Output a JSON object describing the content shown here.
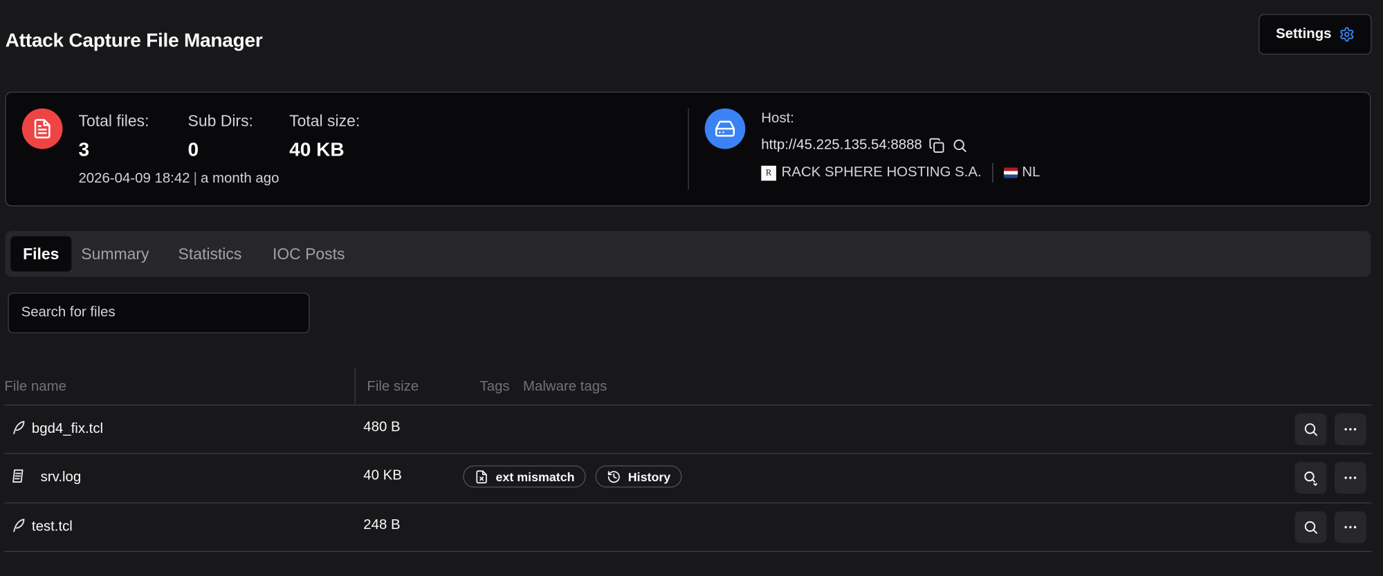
{
  "header": {
    "title": "Attack Capture File Manager",
    "settings_label": "Settings"
  },
  "stats": {
    "total_files_label": "Total files:",
    "total_files_value": "3",
    "sub_dirs_label": "Sub Dirs:",
    "sub_dirs_value": "0",
    "total_size_label": "Total size:",
    "total_size_value": "40 KB",
    "timestamp": "2026-04-09 18:42",
    "relative_time": "a month ago",
    "time_separator": "|"
  },
  "host": {
    "label": "Host:",
    "url": "http://45.225.135.54:8888",
    "org_logo_letter": "R",
    "org_name": "RACK SPHERE HOSTING S.A.",
    "country": "NL"
  },
  "tabs": [
    {
      "label": "Files",
      "active": true
    },
    {
      "label": "Summary",
      "active": false
    },
    {
      "label": "Statistics",
      "active": false
    },
    {
      "label": "IOC Posts",
      "active": false
    }
  ],
  "search": {
    "placeholder": "Search for files",
    "value": ""
  },
  "table": {
    "columns": [
      "File name",
      "File size",
      "Tags",
      "Malware tags"
    ],
    "rows": [
      {
        "name": "bgd4_fix.tcl",
        "size": "480 B",
        "icon": "feather-icon",
        "tags": []
      },
      {
        "name": "srv.log",
        "size": "40 KB",
        "icon": "text-file-icon",
        "tags": [
          {
            "label": "ext mismatch",
            "icon": "file-x-icon"
          },
          {
            "label": "History",
            "icon": "history-icon"
          }
        ]
      },
      {
        "name": "test.tcl",
        "size": "248 B",
        "icon": "feather-icon",
        "tags": []
      }
    ]
  },
  "colors": {
    "background": "#18181b",
    "card": "#09090b",
    "border": "#3f3f46",
    "accent_red": "#ef4444",
    "accent_blue": "#3b82f6",
    "settings_icon": "#3b82f6"
  }
}
